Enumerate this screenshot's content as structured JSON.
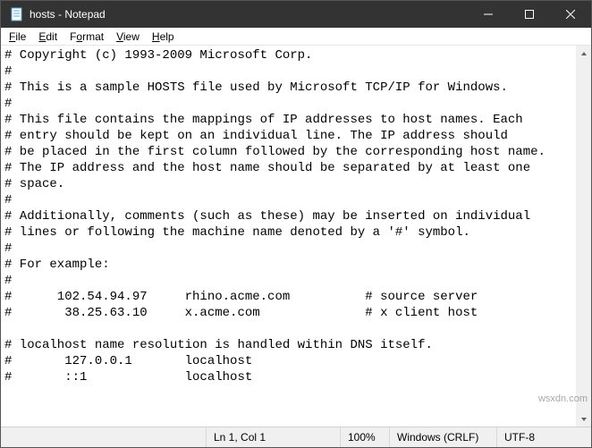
{
  "titlebar": {
    "title": "hosts - Notepad"
  },
  "menu": {
    "file": "File",
    "edit": "Edit",
    "format": "Format",
    "view": "View",
    "help": "Help"
  },
  "editor": {
    "content": "# Copyright (c) 1993-2009 Microsoft Corp.\n#\n# This is a sample HOSTS file used by Microsoft TCP/IP for Windows.\n#\n# This file contains the mappings of IP addresses to host names. Each\n# entry should be kept on an individual line. The IP address should\n# be placed in the first column followed by the corresponding host name.\n# The IP address and the host name should be separated by at least one\n# space.\n#\n# Additionally, comments (such as these) may be inserted on individual\n# lines or following the machine name denoted by a '#' symbol.\n#\n# For example:\n#\n#      102.54.94.97     rhino.acme.com          # source server\n#       38.25.63.10     x.acme.com              # x client host\n\n# localhost name resolution is handled within DNS itself.\n#       127.0.0.1       localhost\n#       ::1             localhost"
  },
  "statusbar": {
    "lncol": "Ln 1, Col 1",
    "zoom": "100%",
    "eol": "Windows (CRLF)",
    "encoding": "UTF-8"
  },
  "watermark": "wsxdn.com"
}
